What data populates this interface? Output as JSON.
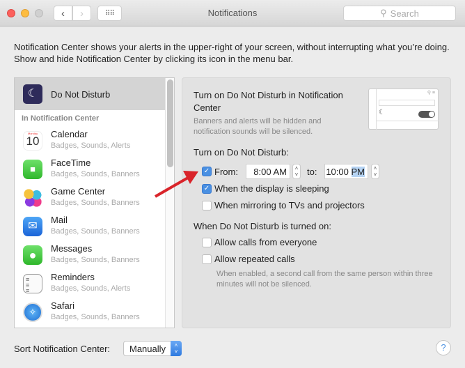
{
  "window": {
    "title": "Notifications",
    "search_placeholder": "Search"
  },
  "intro": "Notification Center shows your alerts in the upper-right of your screen, without interrupting what you’re doing. Show and hide Notification Center by clicking its icon in the menu bar.",
  "sidebar": {
    "selected": "Do Not Disturb",
    "section": "In Notification Center",
    "items": [
      {
        "name": "Calendar",
        "sub": "Badges, Sounds, Alerts",
        "icon": "calendar-icon",
        "cal_month": "Monday",
        "cal_day": "10"
      },
      {
        "name": "FaceTime",
        "sub": "Badges, Sounds, Banners",
        "icon": "facetime-icon"
      },
      {
        "name": "Game Center",
        "sub": "Badges, Sounds, Banners",
        "icon": "game-center-icon"
      },
      {
        "name": "Mail",
        "sub": "Badges, Sounds, Banners",
        "icon": "mail-icon"
      },
      {
        "name": "Messages",
        "sub": "Badges, Sounds, Banners",
        "icon": "messages-icon"
      },
      {
        "name": "Reminders",
        "sub": "Badges, Sounds, Alerts",
        "icon": "reminders-icon"
      },
      {
        "name": "Safari",
        "sub": "Badges, Sounds, Banners",
        "icon": "safari-icon"
      }
    ]
  },
  "panel": {
    "heading": "Turn on Do Not Disturb in Notification Center",
    "heading_desc": "Banners and alerts will be hidden and notification sounds will be silenced.",
    "schedule_label": "Turn on Do Not Disturb:",
    "from_label": "From:",
    "from_time": "8:00 AM",
    "to_label": "to:",
    "to_time": "10:00",
    "to_ampm": "PM",
    "from_checked": true,
    "sleeping_label": "When the display is sleeping",
    "sleeping_checked": true,
    "mirroring_label": "When mirroring to TVs and projectors",
    "mirroring_checked": false,
    "when_on_label": "When Do Not Disturb is turned on:",
    "allow_everyone_label": "Allow calls from everyone",
    "allow_everyone_checked": false,
    "allow_repeated_label": "Allow repeated calls",
    "allow_repeated_checked": false,
    "repeated_note": "When enabled, a second call from the same person within three minutes will not be silenced."
  },
  "footer": {
    "sort_label": "Sort Notification Center:",
    "sort_value": "Manually",
    "help": "?"
  },
  "colors": {
    "accent": "#4a90e2",
    "arrow": "#d9242a"
  }
}
